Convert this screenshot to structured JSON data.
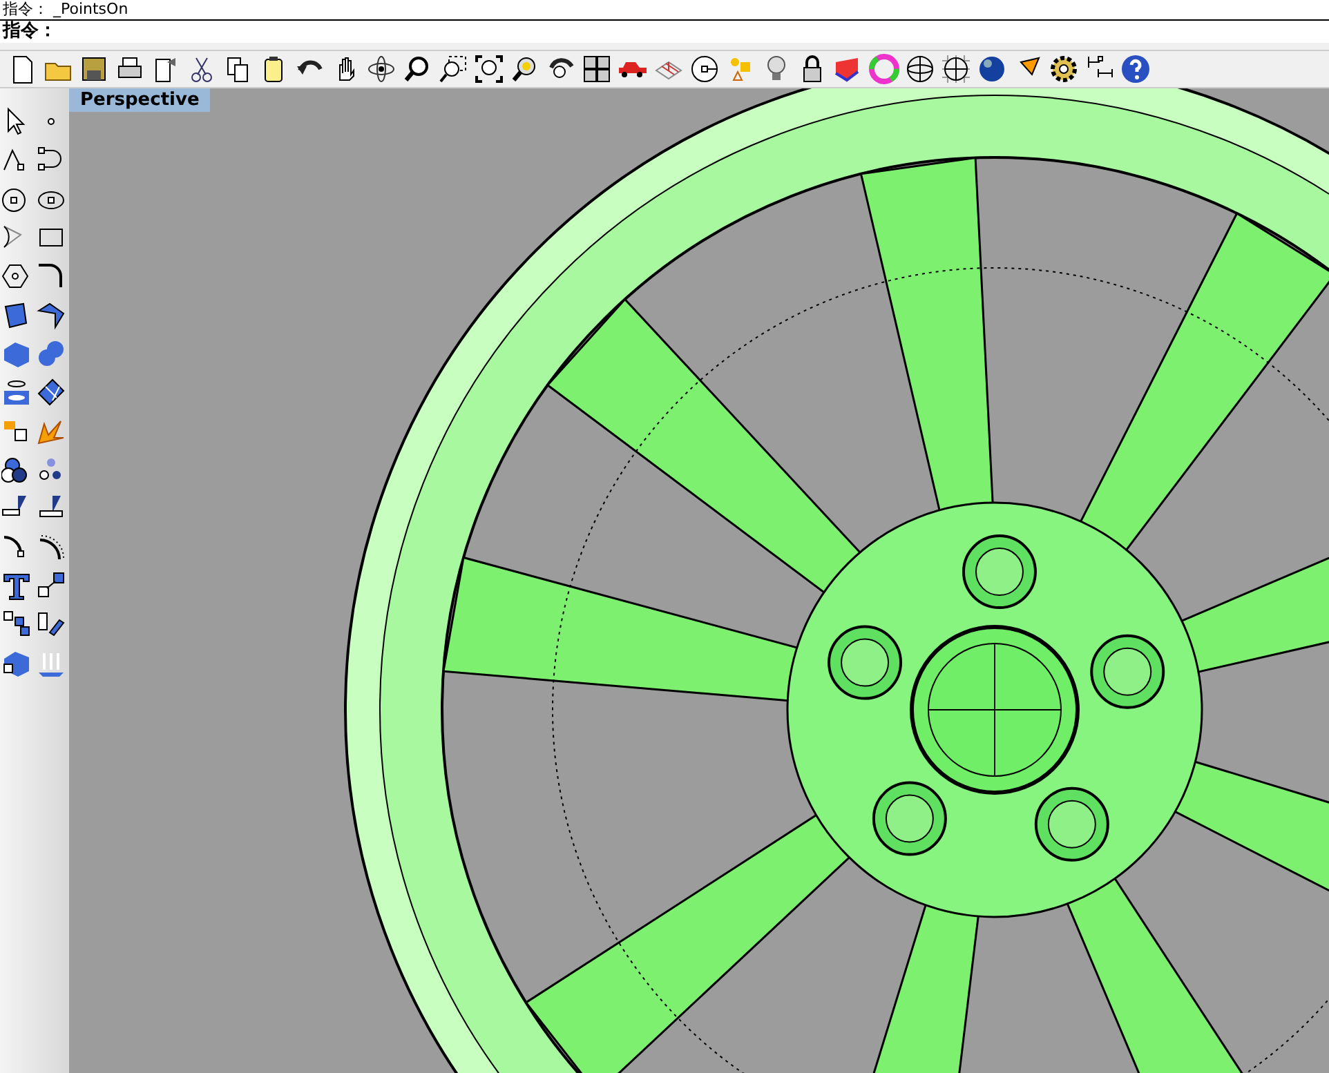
{
  "command_history": "指令： _PointsOn",
  "command_prompt": "指令：",
  "viewport": {
    "title": "Perspective"
  }
}
